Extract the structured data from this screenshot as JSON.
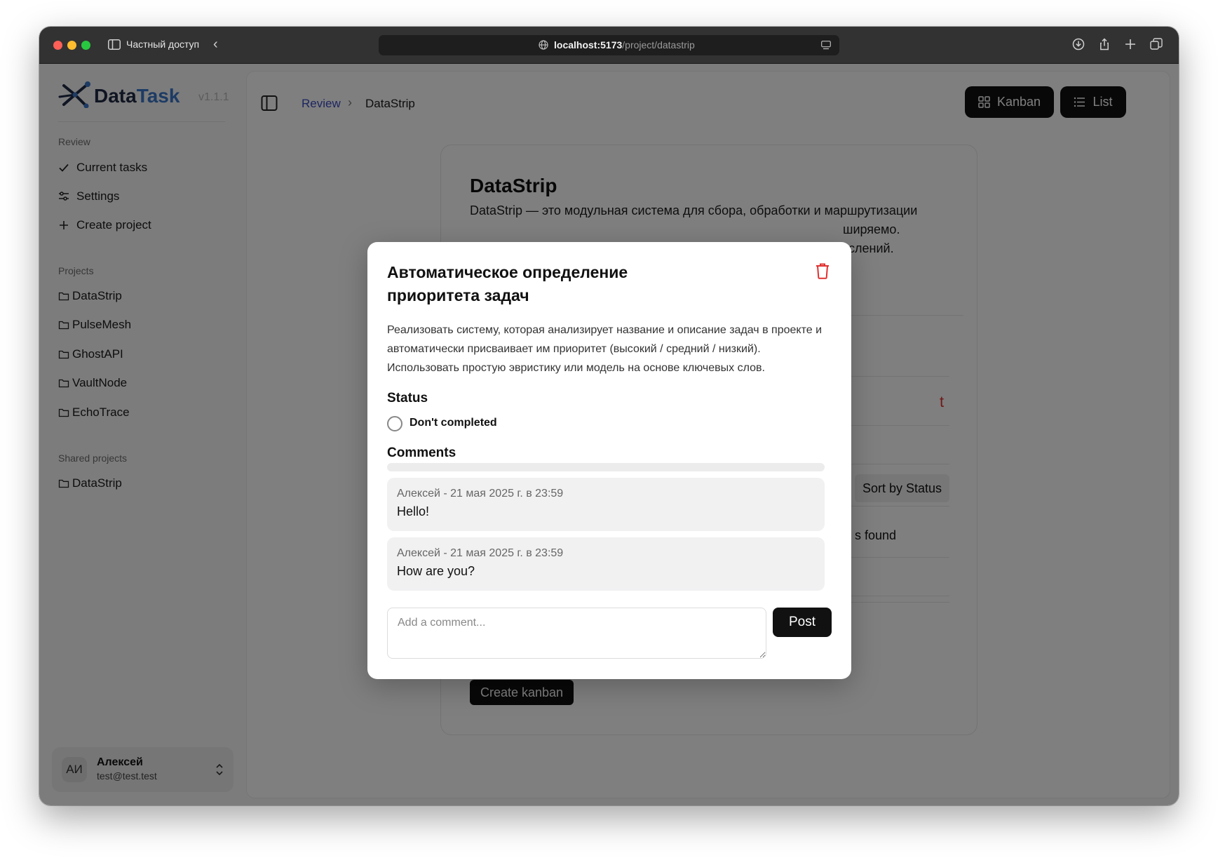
{
  "browser": {
    "private_label": "Частный доступ",
    "url_host": "localhost:5173",
    "url_path": "/project/datastrip"
  },
  "sidebar": {
    "logo_main": "Data",
    "logo_accent": "Task",
    "version": "v1.1.1",
    "review_section": "Review",
    "review_items": [
      {
        "label": "Current tasks",
        "icon": "check-icon"
      },
      {
        "label": "Settings",
        "icon": "sliders-icon"
      },
      {
        "label": "Create project",
        "icon": "plus-icon"
      }
    ],
    "projects_section": "Projects",
    "projects": [
      "DataStrip",
      "PulseMesh",
      "GhostAPI",
      "VaultNode",
      "EchoTrace"
    ],
    "shared_section": "Shared projects",
    "shared_projects": [
      "DataStrip"
    ],
    "user": {
      "initials": "АИ",
      "name": "Алексей",
      "email": "test@test.test"
    }
  },
  "header": {
    "breadcrumb_root": "Review",
    "breadcrumb_current": "DataStrip",
    "kanban_label": "Kanban",
    "list_label": "List"
  },
  "project": {
    "title": "DataStrip",
    "description_line1": "DataStrip — это модульная система для сбора, обработки и маршрутизации",
    "description_line2": "ширяемо.",
    "description_line3": "слений.",
    "sort_label": "Sort by Status",
    "not_found_text": "s found",
    "create_kanban_label": "Create kanban"
  },
  "modal": {
    "title": "Автоматическое определение приоритета задач",
    "description": "Реализовать систему, которая анализирует название и описание задач в проекте и автоматически присваивает им приоритет (высокий / средний / низкий). Использовать простую эвристику или модель на основе ключевых слов.",
    "status_label": "Status",
    "status_value": "Don't completed",
    "comments_label": "Comments",
    "comments": [
      {
        "meta": "Алексей - 21 мая 2025 г. в 23:59",
        "text": "Hello!"
      },
      {
        "meta": "Алексей - 21 мая 2025 г. в 23:59",
        "text": "How are you?"
      }
    ],
    "comment_placeholder": "Add a comment...",
    "post_label": "Post"
  },
  "colors": {
    "accent_blue": "#3b76c9",
    "link_blue": "#3b4cc0",
    "danger_red": "#e03131",
    "button_dark": "#111111"
  }
}
